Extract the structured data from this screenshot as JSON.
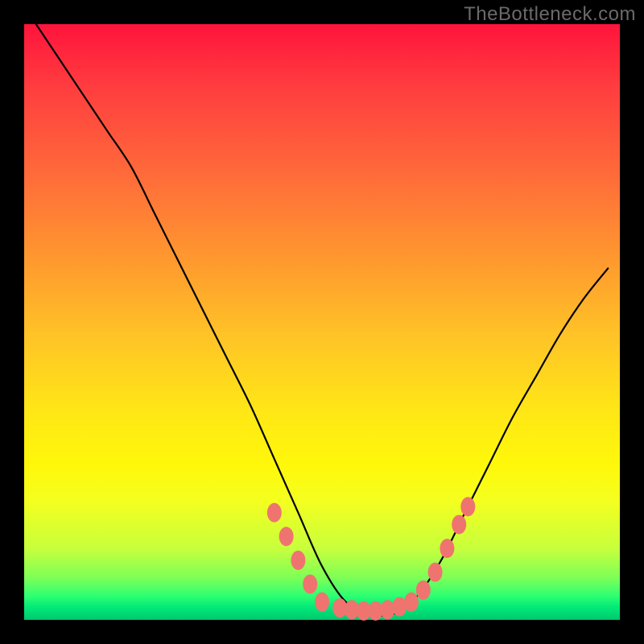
{
  "watermark": "TheBottleneck.com",
  "colors": {
    "page_bg": "#000000",
    "curve": "#000000",
    "dot": "#ef746f"
  },
  "chart_data": {
    "type": "line",
    "title": "",
    "xlabel": "",
    "ylabel": "",
    "xlim": [
      0,
      100
    ],
    "ylim": [
      0,
      100
    ],
    "grid": false,
    "series": [
      {
        "name": "bottleneck-curve",
        "x": [
          2,
          6,
          10,
          14,
          18,
          22,
          26,
          30,
          34,
          38,
          42,
          46,
          50,
          54,
          58,
          62,
          66,
          70,
          74,
          78,
          82,
          86,
          90,
          94,
          98
        ],
        "y": [
          100,
          94,
          88,
          82,
          76,
          68,
          60,
          52,
          44,
          36,
          27,
          18,
          9,
          3,
          1,
          1,
          4,
          10,
          18,
          26,
          34,
          41,
          48,
          54,
          59
        ]
      }
    ],
    "markers": [
      {
        "name": "left-arm-dot-1",
        "x": 42,
        "y": 18
      },
      {
        "name": "left-arm-dot-2",
        "x": 44,
        "y": 14
      },
      {
        "name": "left-arm-dot-3",
        "x": 46,
        "y": 10
      },
      {
        "name": "left-arm-dot-4",
        "x": 48,
        "y": 6
      },
      {
        "name": "left-arm-dot-5",
        "x": 50,
        "y": 3
      },
      {
        "name": "floor-dot-1",
        "x": 53,
        "y": 2
      },
      {
        "name": "floor-dot-2",
        "x": 55,
        "y": 1.7
      },
      {
        "name": "floor-dot-3",
        "x": 57,
        "y": 1.5
      },
      {
        "name": "floor-dot-4",
        "x": 59,
        "y": 1.5
      },
      {
        "name": "floor-dot-5",
        "x": 61,
        "y": 1.7
      },
      {
        "name": "floor-dot-6",
        "x": 63,
        "y": 2.2
      },
      {
        "name": "floor-dot-7",
        "x": 65,
        "y": 3
      },
      {
        "name": "right-arm-dot-1",
        "x": 67,
        "y": 5
      },
      {
        "name": "right-arm-dot-2",
        "x": 69,
        "y": 8
      },
      {
        "name": "right-arm-dot-3",
        "x": 71,
        "y": 12
      },
      {
        "name": "right-arm-dot-4",
        "x": 73,
        "y": 16
      },
      {
        "name": "right-arm-dot-5",
        "x": 74.5,
        "y": 19
      }
    ]
  }
}
